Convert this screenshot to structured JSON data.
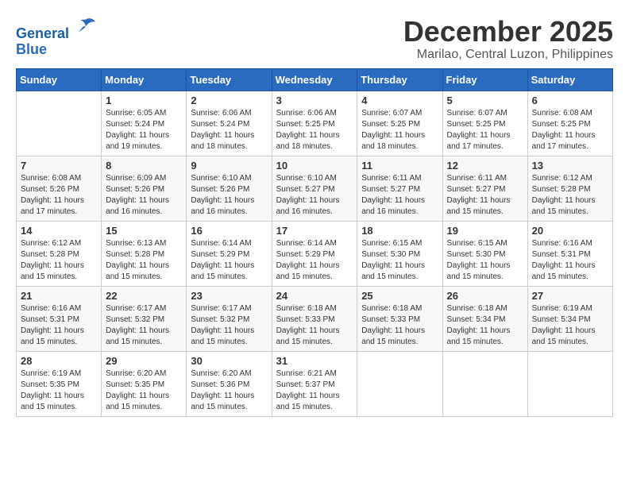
{
  "logo": {
    "line1": "General",
    "line2": "Blue"
  },
  "title": "December 2025",
  "location": "Marilao, Central Luzon, Philippines",
  "days_header": [
    "Sunday",
    "Monday",
    "Tuesday",
    "Wednesday",
    "Thursday",
    "Friday",
    "Saturday"
  ],
  "weeks": [
    [
      {
        "day": "",
        "info": ""
      },
      {
        "day": "1",
        "info": "Sunrise: 6:05 AM\nSunset: 5:24 PM\nDaylight: 11 hours\nand 19 minutes."
      },
      {
        "day": "2",
        "info": "Sunrise: 6:06 AM\nSunset: 5:24 PM\nDaylight: 11 hours\nand 18 minutes."
      },
      {
        "day": "3",
        "info": "Sunrise: 6:06 AM\nSunset: 5:25 PM\nDaylight: 11 hours\nand 18 minutes."
      },
      {
        "day": "4",
        "info": "Sunrise: 6:07 AM\nSunset: 5:25 PM\nDaylight: 11 hours\nand 18 minutes."
      },
      {
        "day": "5",
        "info": "Sunrise: 6:07 AM\nSunset: 5:25 PM\nDaylight: 11 hours\nand 17 minutes."
      },
      {
        "day": "6",
        "info": "Sunrise: 6:08 AM\nSunset: 5:25 PM\nDaylight: 11 hours\nand 17 minutes."
      }
    ],
    [
      {
        "day": "7",
        "info": "Sunrise: 6:08 AM\nSunset: 5:26 PM\nDaylight: 11 hours\nand 17 minutes."
      },
      {
        "day": "8",
        "info": "Sunrise: 6:09 AM\nSunset: 5:26 PM\nDaylight: 11 hours\nand 16 minutes."
      },
      {
        "day": "9",
        "info": "Sunrise: 6:10 AM\nSunset: 5:26 PM\nDaylight: 11 hours\nand 16 minutes."
      },
      {
        "day": "10",
        "info": "Sunrise: 6:10 AM\nSunset: 5:27 PM\nDaylight: 11 hours\nand 16 minutes."
      },
      {
        "day": "11",
        "info": "Sunrise: 6:11 AM\nSunset: 5:27 PM\nDaylight: 11 hours\nand 16 minutes."
      },
      {
        "day": "12",
        "info": "Sunrise: 6:11 AM\nSunset: 5:27 PM\nDaylight: 11 hours\nand 15 minutes."
      },
      {
        "day": "13",
        "info": "Sunrise: 6:12 AM\nSunset: 5:28 PM\nDaylight: 11 hours\nand 15 minutes."
      }
    ],
    [
      {
        "day": "14",
        "info": "Sunrise: 6:12 AM\nSunset: 5:28 PM\nDaylight: 11 hours\nand 15 minutes."
      },
      {
        "day": "15",
        "info": "Sunrise: 6:13 AM\nSunset: 5:28 PM\nDaylight: 11 hours\nand 15 minutes."
      },
      {
        "day": "16",
        "info": "Sunrise: 6:14 AM\nSunset: 5:29 PM\nDaylight: 11 hours\nand 15 minutes."
      },
      {
        "day": "17",
        "info": "Sunrise: 6:14 AM\nSunset: 5:29 PM\nDaylight: 11 hours\nand 15 minutes."
      },
      {
        "day": "18",
        "info": "Sunrise: 6:15 AM\nSunset: 5:30 PM\nDaylight: 11 hours\nand 15 minutes."
      },
      {
        "day": "19",
        "info": "Sunrise: 6:15 AM\nSunset: 5:30 PM\nDaylight: 11 hours\nand 15 minutes."
      },
      {
        "day": "20",
        "info": "Sunrise: 6:16 AM\nSunset: 5:31 PM\nDaylight: 11 hours\nand 15 minutes."
      }
    ],
    [
      {
        "day": "21",
        "info": "Sunrise: 6:16 AM\nSunset: 5:31 PM\nDaylight: 11 hours\nand 15 minutes."
      },
      {
        "day": "22",
        "info": "Sunrise: 6:17 AM\nSunset: 5:32 PM\nDaylight: 11 hours\nand 15 minutes."
      },
      {
        "day": "23",
        "info": "Sunrise: 6:17 AM\nSunset: 5:32 PM\nDaylight: 11 hours\nand 15 minutes."
      },
      {
        "day": "24",
        "info": "Sunrise: 6:18 AM\nSunset: 5:33 PM\nDaylight: 11 hours\nand 15 minutes."
      },
      {
        "day": "25",
        "info": "Sunrise: 6:18 AM\nSunset: 5:33 PM\nDaylight: 11 hours\nand 15 minutes."
      },
      {
        "day": "26",
        "info": "Sunrise: 6:18 AM\nSunset: 5:34 PM\nDaylight: 11 hours\nand 15 minutes."
      },
      {
        "day": "27",
        "info": "Sunrise: 6:19 AM\nSunset: 5:34 PM\nDaylight: 11 hours\nand 15 minutes."
      }
    ],
    [
      {
        "day": "28",
        "info": "Sunrise: 6:19 AM\nSunset: 5:35 PM\nDaylight: 11 hours\nand 15 minutes."
      },
      {
        "day": "29",
        "info": "Sunrise: 6:20 AM\nSunset: 5:35 PM\nDaylight: 11 hours\nand 15 minutes."
      },
      {
        "day": "30",
        "info": "Sunrise: 6:20 AM\nSunset: 5:36 PM\nDaylight: 11 hours\nand 15 minutes."
      },
      {
        "day": "31",
        "info": "Sunrise: 6:21 AM\nSunset: 5:37 PM\nDaylight: 11 hours\nand 15 minutes."
      },
      {
        "day": "",
        "info": ""
      },
      {
        "day": "",
        "info": ""
      },
      {
        "day": "",
        "info": ""
      }
    ]
  ]
}
